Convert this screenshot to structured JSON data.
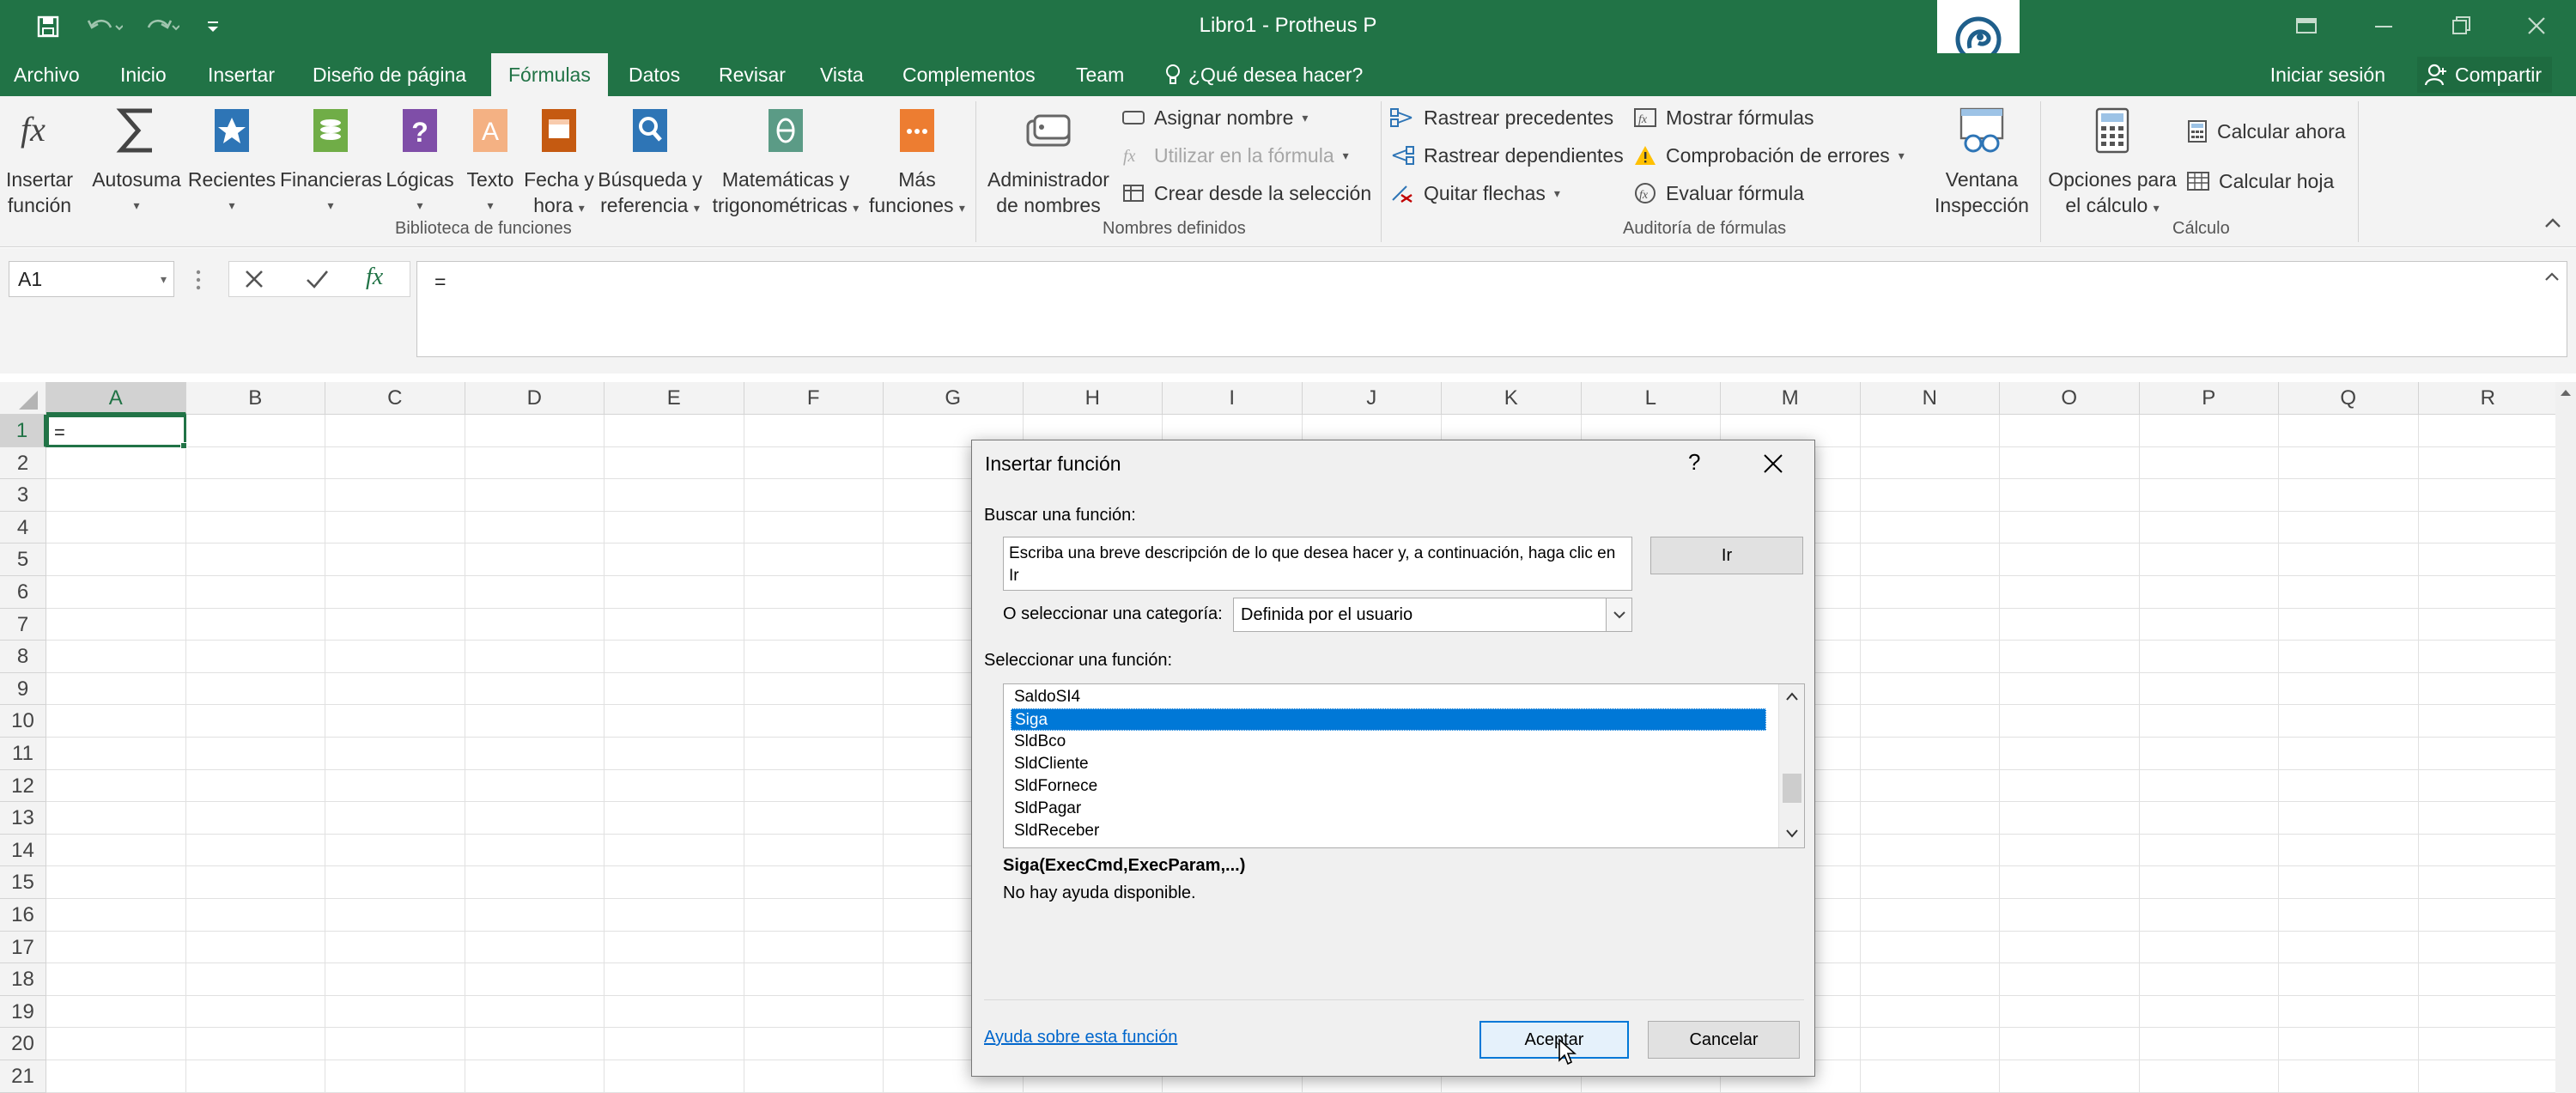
{
  "window": {
    "title": "Libro1 - Protheus P",
    "minimize_icon": "minimize-icon",
    "restore_icon": "restore-icon",
    "close_icon": "close-icon"
  },
  "tabs": [
    "Archivo",
    "Inicio",
    "Insertar",
    "Diseño de página",
    "Fórmulas",
    "Datos",
    "Revisar",
    "Vista",
    "Complementos",
    "Team"
  ],
  "active_tab": "Fórmulas",
  "tell_me": "¿Qué desea hacer?",
  "signin": "Iniciar sesión",
  "share": "Compartir",
  "ribbon": {
    "biblioteca": {
      "group_label": "Biblioteca de funciones",
      "insert_function": [
        "Insertar",
        "función"
      ],
      "autosum": "Autosuma",
      "recent": "Recientes",
      "financial": "Financieras",
      "logical": "Lógicas",
      "text": "Texto",
      "datetime": [
        "Fecha y",
        "hora"
      ],
      "lookup": [
        "Búsqueda y",
        "referencia"
      ],
      "math": [
        "Matemáticas y",
        "trigonométricas"
      ],
      "more": [
        "Más",
        "funciones"
      ]
    },
    "nombres": {
      "group_label": "Nombres definidos",
      "name_manager": [
        "Administrador",
        "de nombres"
      ],
      "define_name": "Asignar nombre",
      "use_in_formula": "Utilizar en la fórmula",
      "create_from_selection": "Crear desde la selección"
    },
    "auditoria": {
      "group_label": "Auditoría de fórmulas",
      "trace_precedents": "Rastrear precedentes",
      "trace_dependents": "Rastrear dependientes",
      "remove_arrows": "Quitar flechas",
      "show_formulas": "Mostrar fórmulas",
      "error_checking": "Comprobación de errores",
      "evaluate_formula": "Evaluar fórmula",
      "watch_window": [
        "Ventana",
        "Inspección"
      ]
    },
    "calculo": {
      "group_label": "Cálculo",
      "calc_options": [
        "Opciones para",
        "el cálculo"
      ],
      "calc_now": "Calcular ahora",
      "calc_sheet": "Calcular hoja"
    }
  },
  "formula_bar": {
    "name_box": "A1",
    "fx": "fx",
    "content": "="
  },
  "sheet": {
    "columns": [
      "A",
      "B",
      "C",
      "D",
      "E",
      "F",
      "G",
      "H",
      "I",
      "J",
      "K",
      "L",
      "M",
      "N",
      "O",
      "P",
      "Q",
      "R"
    ],
    "rows": [
      "1",
      "2",
      "3",
      "4",
      "5",
      "6",
      "7",
      "8",
      "9",
      "10",
      "11",
      "12",
      "13",
      "14",
      "15",
      "16",
      "17",
      "18",
      "19",
      "20",
      "21"
    ],
    "active_cell_value": "="
  },
  "dialog": {
    "title": "Insertar función",
    "help_icon": "?",
    "search_label": "Buscar una función:",
    "search_text": "Escriba una breve descripción de lo que desea hacer y, a continuación, haga clic en Ir",
    "go_button": "Ir",
    "category_label": "O seleccionar una categoría:",
    "category_value": "Definida por el usuario",
    "select_label": "Seleccionar una función:",
    "functions": [
      "SaldoSI4",
      "Siga",
      "SldBco",
      "SldCliente",
      "SldFornece",
      "SldPagar",
      "SldReceber"
    ],
    "selected_function": "Siga",
    "signature": "Siga(ExecCmd,ExecParam,...)",
    "description": "No hay ayuda disponible.",
    "help_link": "Ayuda sobre esta función",
    "ok_button": "Aceptar",
    "cancel_button": "Cancelar"
  }
}
